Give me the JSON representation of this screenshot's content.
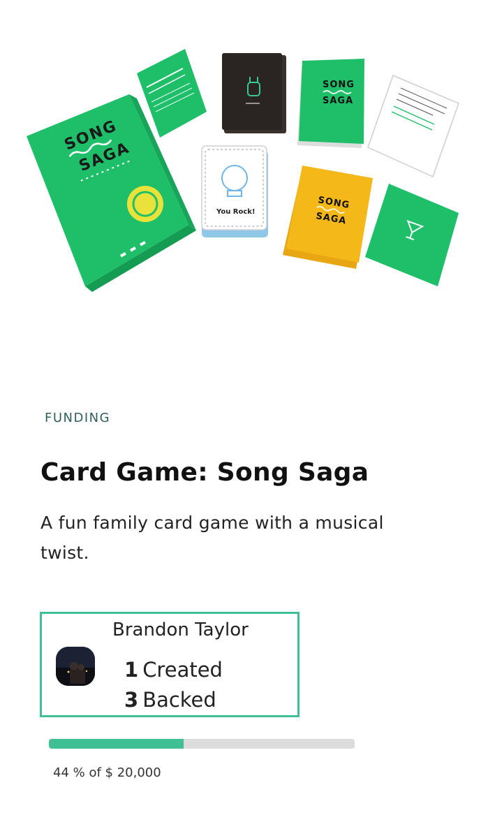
{
  "colors": {
    "accent": "#3fbf94",
    "card_green": "#1fbf6a",
    "card_yellow": "#f4b819",
    "card_black": "#2a2422",
    "track": "#dcdcdc"
  },
  "hero": {
    "box_logo_line1": "SONG",
    "box_logo_line2": "SAGA",
    "card_caption": "You Rock!",
    "image_icons": [
      "rock-hand-icon",
      "cocktail-icon",
      "globe-icon"
    ]
  },
  "project": {
    "status": "FUNDING",
    "title": "Card Game: Song Saga",
    "subtitle": "A fun family card game with a musical twist."
  },
  "creator": {
    "name": "Brandon Taylor",
    "created_count": "1",
    "created_label": "Created",
    "backed_count": "3",
    "backed_label": "Backed"
  },
  "funding": {
    "percent": 44,
    "progress_text": "44 % of $ 20,000"
  }
}
